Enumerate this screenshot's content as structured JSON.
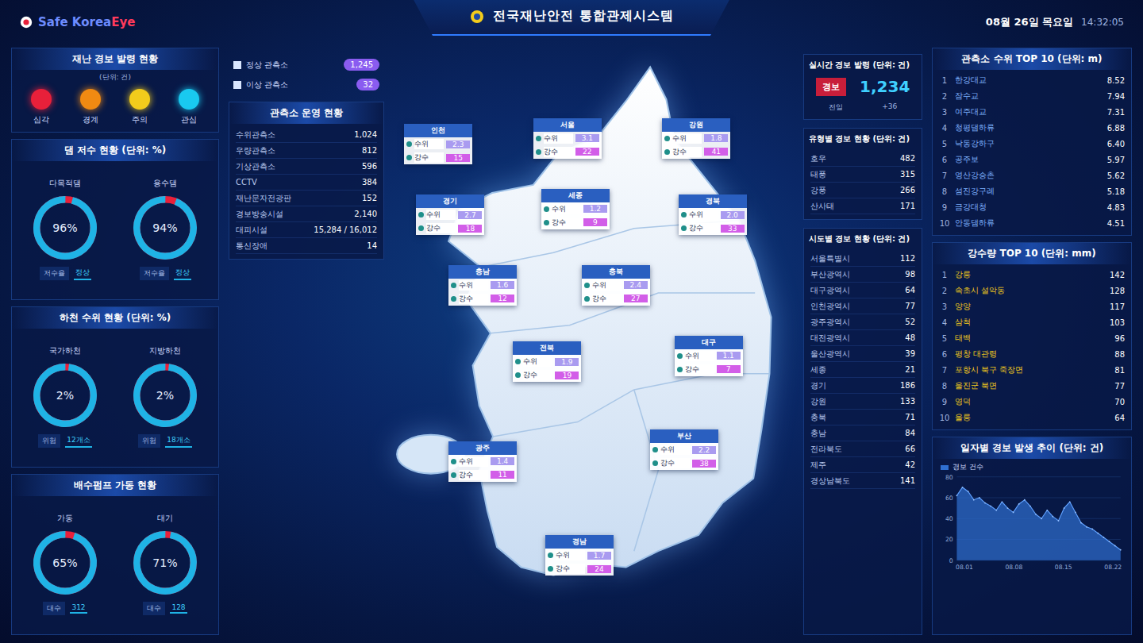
{
  "header": {
    "logo": {
      "main": "Safe Korea ",
      "accent": "Eye"
    },
    "title": "전국재난안전 통합관제시스템",
    "date": "08월 26일 목요일",
    "time": "14:32:05"
  },
  "alert_panel": {
    "title": "재난 경보 발령 현황",
    "subtitle": "(단위: 건)",
    "levels": [
      {
        "label": "심각",
        "color": "#e8203a"
      },
      {
        "label": "경계",
        "color": "#f08a12"
      },
      {
        "label": "주의",
        "color": "#f2cc1c"
      },
      {
        "label": "관심",
        "color": "#19c9f0"
      }
    ]
  },
  "gauge_panels": [
    {
      "title": "댐 저수 현황 (단위: %)",
      "gauges": [
        {
          "label": "다목적댐",
          "level": 0.96,
          "reading": "96%",
          "key": "저수율",
          "value": "정상"
        },
        {
          "label": "용수댐",
          "level": 0.94,
          "reading": "94%",
          "key": "저수율",
          "value": "정상"
        }
      ]
    },
    {
      "title": "하천 수위 현황 (단위: %)",
      "gauges": [
        {
          "label": "국가하천",
          "level": 0.98,
          "reading": "2%",
          "key": "위험",
          "value": "12개소"
        },
        {
          "label": "지방하천",
          "level": 0.98,
          "reading": "2%",
          "key": "위험",
          "value": "18개소"
        }
      ]
    },
    {
      "title": "배수펌프 가동 현황",
      "gauges": [
        {
          "label": "가동",
          "level": 0.95,
          "reading": "65%",
          "key": "대수",
          "value": "312"
        },
        {
          "label": "대기",
          "level": 0.97,
          "reading": "71%",
          "key": "대수",
          "value": "128"
        }
      ]
    }
  ],
  "legend": [
    {
      "label": "정상 관측소",
      "value": "1,245"
    },
    {
      "label": "이상 관측소",
      "value": "32"
    }
  ],
  "station_table": {
    "title": "관측소 운영 현황",
    "rows": [
      {
        "label": "수위관측소",
        "value": "1,024"
      },
      {
        "label": "우량관측소",
        "value": "812"
      },
      {
        "label": "기상관측소",
        "value": "596"
      },
      {
        "label": "CCTV",
        "value": "384"
      },
      {
        "label": "재난문자전광판",
        "value": "152"
      },
      {
        "label": "경보방송시설",
        "value": "2,140"
      },
      {
        "label": "대피시설",
        "value": "15,284 / 16,012"
      },
      {
        "label": "통신장애",
        "value": "14"
      }
    ]
  },
  "regions": [
    {
      "name": "인천",
      "rows": [
        {
          "label": "수위",
          "value": "2.3"
        },
        {
          "label": "강수",
          "value": "15"
        }
      ]
    },
    {
      "name": "서울",
      "rows": [
        {
          "label": "수위",
          "value": "3.1"
        },
        {
          "label": "강수",
          "value": "22"
        }
      ]
    },
    {
      "name": "강원",
      "rows": [
        {
          "label": "수위",
          "value": "1.8"
        },
        {
          "label": "강수",
          "value": "41"
        }
      ]
    },
    {
      "name": "경기",
      "rows": [
        {
          "label": "수위",
          "value": "2.7"
        },
        {
          "label": "강수",
          "value": "18"
        }
      ]
    },
    {
      "name": "세종",
      "rows": [
        {
          "label": "수위",
          "value": "1.2"
        },
        {
          "label": "강수",
          "value": "9"
        }
      ]
    },
    {
      "name": "경북",
      "rows": [
        {
          "label": "수위",
          "value": "2.0"
        },
        {
          "label": "강수",
          "value": "33"
        }
      ]
    },
    {
      "name": "충남",
      "rows": [
        {
          "label": "수위",
          "value": "1.6"
        },
        {
          "label": "강수",
          "value": "12"
        }
      ]
    },
    {
      "name": "충북",
      "rows": [
        {
          "label": "수위",
          "value": "2.4"
        },
        {
          "label": "강수",
          "value": "27"
        }
      ]
    },
    {
      "name": "전북",
      "rows": [
        {
          "label": "수위",
          "value": "1.9"
        },
        {
          "label": "강수",
          "value": "19"
        }
      ]
    },
    {
      "name": "대구",
      "rows": [
        {
          "label": "수위",
          "value": "1.1"
        },
        {
          "label": "강수",
          "value": "7"
        }
      ]
    },
    {
      "name": "광주",
      "rows": [
        {
          "label": "수위",
          "value": "1.4"
        },
        {
          "label": "강수",
          "value": "11"
        }
      ]
    },
    {
      "name": "부산",
      "rows": [
        {
          "label": "수위",
          "value": "2.2"
        },
        {
          "label": "강수",
          "value": "38"
        }
      ]
    },
    {
      "name": "경남",
      "rows": [
        {
          "label": "수위",
          "value": "1.7"
        },
        {
          "label": "강수",
          "value": "24"
        }
      ]
    }
  ],
  "live_box": {
    "title": "실시간 경보 발령 (단위: 건)",
    "badge": "경보",
    "count": "1,234",
    "sub_label": "전일",
    "sub_value": "+36"
  },
  "type_table": {
    "title": "유형별 경보 현황 (단위: 건)",
    "rows": [
      {
        "label": "호우",
        "value": "482"
      },
      {
        "label": "태풍",
        "value": "315"
      },
      {
        "label": "강풍",
        "value": "266"
      },
      {
        "label": "산사태",
        "value": "171"
      }
    ]
  },
  "city_table": {
    "title": "시도별 경보 현황 (단위: 건)",
    "rows": [
      {
        "label": "서울특별시",
        "value": "112"
      },
      {
        "label": "부산광역시",
        "value": "98"
      },
      {
        "label": "대구광역시",
        "value": "64"
      },
      {
        "label": "인천광역시",
        "value": "77"
      },
      {
        "label": "광주광역시",
        "value": "52"
      },
      {
        "label": "대전광역시",
        "value": "48"
      },
      {
        "label": "울산광역시",
        "value": "39"
      },
      {
        "label": "세종",
        "value": "21"
      },
      {
        "label": "경기",
        "value": "186"
      },
      {
        "label": "강원",
        "value": "133"
      },
      {
        "label": "충북",
        "value": "71"
      },
      {
        "label": "충남",
        "value": "84"
      },
      {
        "label": "전라북도",
        "value": "66"
      },
      {
        "label": "제주",
        "value": "42"
      },
      {
        "label": "경상남북도",
        "value": "141"
      }
    ]
  },
  "level_top": {
    "title": "관측소 수위 TOP 10 (단위: m)",
    "rows": [
      {
        "rank": "1",
        "name": "한강대교",
        "value": "8.52"
      },
      {
        "rank": "2",
        "name": "잠수교",
        "value": "7.94"
      },
      {
        "rank": "3",
        "name": "여주대교",
        "value": "7.31"
      },
      {
        "rank": "4",
        "name": "청평댐하류",
        "value": "6.88"
      },
      {
        "rank": "5",
        "name": "낙동강하구",
        "value": "6.40"
      },
      {
        "rank": "6",
        "name": "공주보",
        "value": "5.97"
      },
      {
        "rank": "7",
        "name": "영산강승촌",
        "value": "5.62"
      },
      {
        "rank": "8",
        "name": "섬진강구례",
        "value": "5.18"
      },
      {
        "rank": "9",
        "name": "금강대청",
        "value": "4.83"
      },
      {
        "rank": "10",
        "name": "안동댐하류",
        "value": "4.51"
      }
    ]
  },
  "rain_top": {
    "title": "강수량 TOP 10 (단위: mm)",
    "rows": [
      {
        "rank": "1",
        "name": "강릉",
        "value": "142"
      },
      {
        "rank": "2",
        "name": "속초시 설악동",
        "value": "128"
      },
      {
        "rank": "3",
        "name": "양양",
        "value": "117"
      },
      {
        "rank": "4",
        "name": "삼척",
        "value": "103"
      },
      {
        "rank": "5",
        "name": "태백",
        "value": "96"
      },
      {
        "rank": "6",
        "name": "평창 대관령",
        "value": "88"
      },
      {
        "rank": "7",
        "name": "포항시 북구 죽장면",
        "value": "81"
      },
      {
        "rank": "8",
        "name": "울진군 북면",
        "value": "77"
      },
      {
        "rank": "9",
        "name": "영덕",
        "value": "70"
      },
      {
        "rank": "10",
        "name": "울릉",
        "value": "64"
      }
    ]
  },
  "chart": {
    "title": "일자별 경보 발생 추이 (단위: 건)",
    "legend": "경보 건수",
    "y_ticks": [
      "0",
      "20",
      "40",
      "60",
      "80"
    ],
    "x_labels": [
      "08.01",
      "08.08",
      "08.15",
      "08.22"
    ],
    "values": [
      62,
      70,
      66,
      58,
      60,
      55,
      52,
      48,
      56,
      50,
      46,
      54,
      58,
      52,
      44,
      40,
      48,
      42,
      38,
      50,
      56,
      46,
      36,
      32,
      30,
      26,
      22,
      18,
      14,
      10
    ]
  }
}
